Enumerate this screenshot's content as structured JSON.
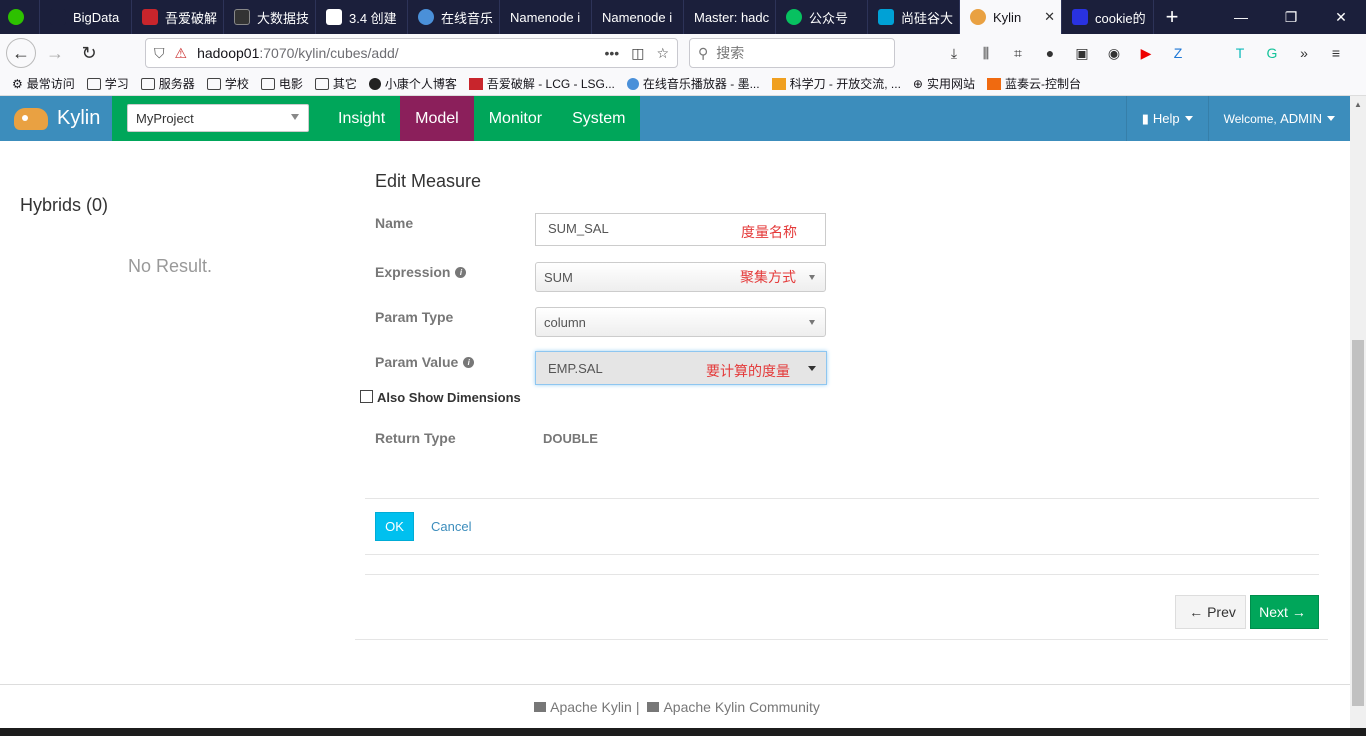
{
  "browser": {
    "tabs": [
      {
        "label": "",
        "icon": "wechat-icon",
        "color": "#2dc100"
      },
      {
        "label": "BigData",
        "icon": "page-icon",
        "color": "#1b1f3b"
      },
      {
        "label": "吾爱破解",
        "icon": "pojie-icon",
        "color": "#c8252c"
      },
      {
        "label": "大数据技",
        "icon": "page-icon",
        "color": "#333333"
      },
      {
        "label": "3.4 创建",
        "icon": "book-icon",
        "color": "#ffffff"
      },
      {
        "label": "在线音乐",
        "icon": "globe-icon",
        "color": "#4a90d9"
      },
      {
        "label": "Namenode i",
        "icon": "page-icon",
        "color": "#1b1f3b"
      },
      {
        "label": "Namenode i",
        "icon": "page-icon",
        "color": "#1b1f3b"
      },
      {
        "label": "Master: hadc",
        "icon": "page-icon",
        "color": "#1b1f3b"
      },
      {
        "label": "公众号",
        "icon": "wechat-mp-icon",
        "color": "#07c160"
      },
      {
        "label": "尚硅谷大",
        "icon": "bilibili-icon",
        "color": "#00a1d6"
      },
      {
        "label": "Kylin",
        "icon": "kylin-icon",
        "color": "#e9a142",
        "active": true
      },
      {
        "label": "cookie的",
        "icon": "baidu-icon",
        "color": "#2932e1"
      }
    ],
    "url_host": "hadoop01",
    "url_path": ":7070/kylin/cubes/add/",
    "search_placeholder": "搜索",
    "bookmarks": [
      {
        "label": "最常访问",
        "icon": "gear-icon"
      },
      {
        "label": "学习",
        "icon": "folder-icon"
      },
      {
        "label": "服务器",
        "icon": "folder-icon"
      },
      {
        "label": "学校",
        "icon": "folder-icon"
      },
      {
        "label": "电影",
        "icon": "folder-icon"
      },
      {
        "label": "其它",
        "icon": "folder-icon"
      },
      {
        "label": "小康个人博客",
        "icon": "blog-icon"
      },
      {
        "label": "吾爱破解 - LCG - LSG...",
        "icon": "pojie-icon"
      },
      {
        "label": "在线音乐播放器 - 墨...",
        "icon": "globe-icon"
      },
      {
        "label": "科学刀 - 开放交流, ...",
        "icon": "knife-icon"
      },
      {
        "label": "实用网站",
        "icon": "globe-icon"
      },
      {
        "label": "蓝奏云-控制台",
        "icon": "lanzou-icon"
      }
    ]
  },
  "kylin": {
    "brand": "Kylin",
    "project": "MyProject",
    "menu": [
      "Insight",
      "Model",
      "Monitor",
      "System"
    ],
    "active_menu": "Model",
    "help": "Help",
    "welcome": "Welcome,",
    "user": "ADMIN"
  },
  "left": {
    "hybrids_title": "Hybrids (0)",
    "no_result": "No Result."
  },
  "form": {
    "title": "Edit Measure",
    "name_label": "Name",
    "name_value": "SUM_SAL",
    "name_note": "度量名称",
    "expression_label": "Expression",
    "expression_value": "SUM",
    "expression_note": "聚集方式",
    "param_type_label": "Param Type",
    "param_type_value": "column",
    "param_value_label": "Param Value",
    "param_value_value": "EMP.SAL",
    "param_value_note": "要计算的度量",
    "also_show_dimensions": "Also Show Dimensions",
    "return_type_label": "Return Type",
    "return_type_value": "DOUBLE",
    "ok": "OK",
    "cancel": "Cancel"
  },
  "wizard": {
    "prev": "Prev",
    "next": "Next"
  },
  "footer": {
    "link1": "Apache Kylin",
    "separator": "|",
    "link2": "Apache Kylin Community"
  },
  "colors": {
    "kylin_header": "#3c8dbc",
    "menu_green": "#00a65a",
    "menu_active": "#8b1f5b",
    "annotation_red": "#e43a3a",
    "ok_button": "#00c0ef"
  }
}
